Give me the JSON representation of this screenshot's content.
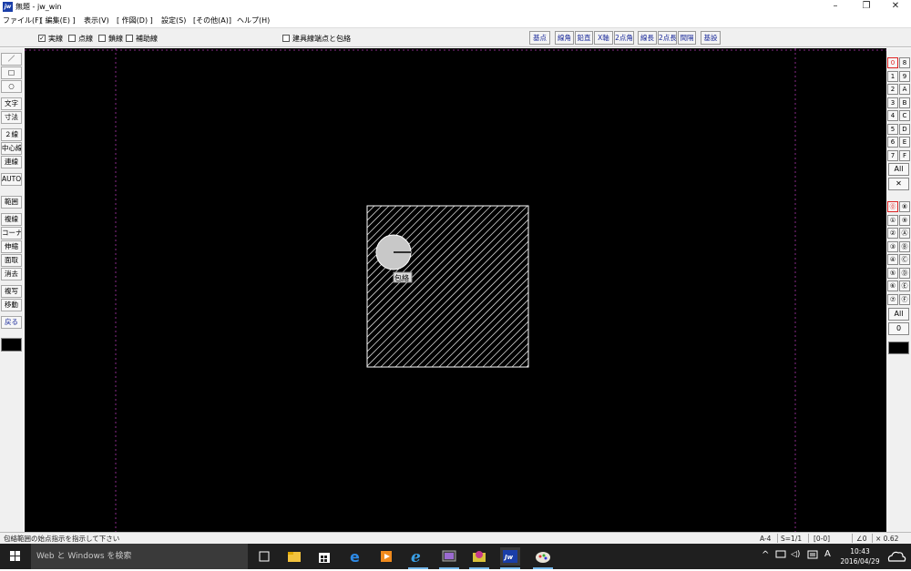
{
  "window": {
    "title": "無題 - jw_win",
    "app_icon_label": "jw",
    "controls": {
      "minimize": "–",
      "restore": "❐",
      "close": "✕"
    }
  },
  "menu": [
    "ファイル(F)",
    "[ 編集(E) ]",
    "表示(V)",
    "[ 作図(D) ]",
    "設定(S)",
    "[その他(A)]",
    "ヘルプ(H)"
  ],
  "toolbar": {
    "line_types": [
      {
        "label": "実線",
        "checked": true
      },
      {
        "label": "点線",
        "checked": false
      },
      {
        "label": "鎖線",
        "checked": false
      },
      {
        "label": "補助線",
        "checked": false
      }
    ],
    "fitting": {
      "label": "建具線端点と包絡",
      "checked": false
    },
    "buttons": [
      "基点",
      "線角",
      "鉛直",
      "X軸",
      "2点角",
      "線長",
      "2点長",
      "間隔",
      "基設"
    ]
  },
  "left_tools": [
    "／",
    "□",
    "○",
    "文字",
    "寸法",
    "２線",
    "中心線",
    "連線",
    "AUTO",
    "範囲",
    "複線",
    "コーナー",
    "伸縮",
    "面取",
    "消去",
    "複写",
    "移動",
    "戻る"
  ],
  "right_panel": {
    "layer_groups": [
      [
        "0",
        "8"
      ],
      [
        "1",
        "9"
      ],
      [
        "2",
        "A"
      ],
      [
        "3",
        "B"
      ],
      [
        "4",
        "C"
      ],
      [
        "5",
        "D"
      ],
      [
        "6",
        "E"
      ],
      [
        "7",
        "F"
      ]
    ],
    "layers": [
      [
        "⓪",
        "⑧"
      ],
      [
        "①",
        "⑨"
      ],
      [
        "②",
        "Ⓐ"
      ],
      [
        "③",
        "Ⓑ"
      ],
      [
        "④",
        "Ⓒ"
      ],
      [
        "⑤",
        "Ⓓ"
      ],
      [
        "⑥",
        "Ⓔ"
      ],
      [
        "⑦",
        "Ⓕ"
      ]
    ],
    "all_label": "All",
    "cross_label": "✕",
    "all_label_2": "All",
    "zero_label": "0"
  },
  "drawing": {
    "cursor_tag": "包絡",
    "colors": {
      "frame": "#ffffff",
      "hatch": "#cfcfcf",
      "circle": "#c8c8c8",
      "border": "#8a2a8a"
    }
  },
  "status": {
    "message": "包絡範囲の始点指示を指示して下さい",
    "paper": "A-4",
    "scale": "S=1/1",
    "layer": "[0-0]",
    "angle": "∠0",
    "zoom": "× 0.62"
  },
  "taskbar": {
    "search_placeholder": "Web と Windows を検索",
    "ime": "A",
    "time": "10:43",
    "date": "2016/04/29"
  }
}
